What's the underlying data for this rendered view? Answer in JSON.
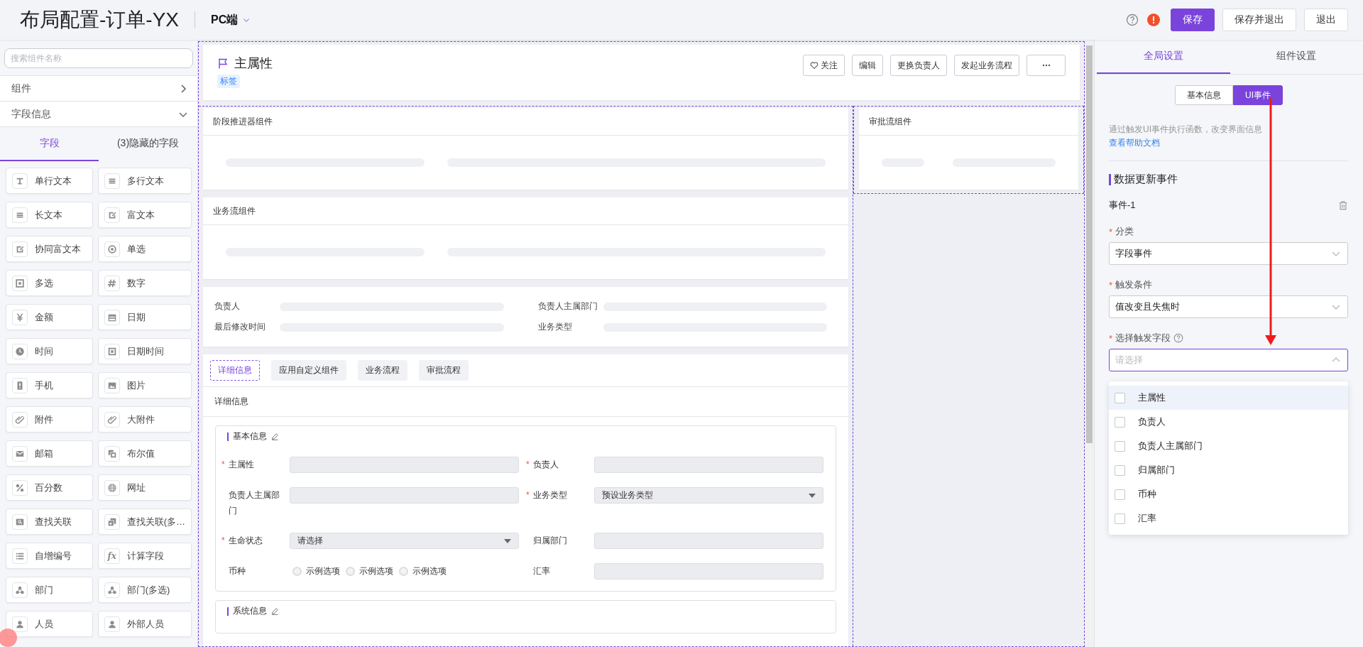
{
  "header": {
    "title": "布局配置-订单-YX",
    "platform": "PC端",
    "buttons": [
      {
        "label": "保存",
        "kind": "primary"
      },
      {
        "label": "保存并退出",
        "kind": "default"
      },
      {
        "label": "退出",
        "kind": "default"
      }
    ]
  },
  "sidebar": {
    "search": {
      "placeholder": "搜索组件名称"
    },
    "sections": [
      {
        "label": "组件",
        "expanded": false
      },
      {
        "label": "字段信息",
        "expanded": true
      }
    ],
    "tabs": [
      {
        "label": "字段",
        "selected": true
      },
      {
        "label": "(3)隐藏的字段",
        "selected": false
      }
    ],
    "fields": [
      {
        "label": "单行文本",
        "kind": "ibeam"
      },
      {
        "label": "多行文本",
        "kind": "lines"
      },
      {
        "label": "长文本",
        "kind": "lines"
      },
      {
        "label": "富文本",
        "kind": "editdoc"
      },
      {
        "label": "协同富文本",
        "kind": "editdoc"
      },
      {
        "label": "单选",
        "kind": "radio"
      },
      {
        "label": "多选",
        "kind": "checkbox"
      },
      {
        "label": "数字",
        "kind": "hash"
      },
      {
        "label": "金额",
        "kind": "yen"
      },
      {
        "label": "日期",
        "kind": "calendar"
      },
      {
        "label": "时间",
        "kind": "clock"
      },
      {
        "label": "日期时间",
        "kind": "datetime"
      },
      {
        "label": "手机",
        "kind": "phone"
      },
      {
        "label": "图片",
        "kind": "image"
      },
      {
        "label": "附件",
        "kind": "clip"
      },
      {
        "label": "大附件",
        "kind": "clip"
      },
      {
        "label": "邮箱",
        "kind": "mail"
      },
      {
        "label": "布尔值",
        "kind": "squares"
      },
      {
        "label": "百分数",
        "kind": "percent"
      },
      {
        "label": "网址",
        "kind": "globe"
      },
      {
        "label": "查找关联",
        "kind": "lookup"
      },
      {
        "label": "查找关联(多…",
        "kind": "squares2"
      },
      {
        "label": "自增编号",
        "kind": "list"
      },
      {
        "label": "计算字段",
        "kind": "glyph",
        "glyph": "fx"
      },
      {
        "label": "部门",
        "kind": "dept"
      },
      {
        "label": "部门(多选)",
        "kind": "dept"
      },
      {
        "label": "人员",
        "kind": "person"
      },
      {
        "label": "外部人员",
        "kind": "person"
      }
    ]
  },
  "canvas": {
    "record": {
      "title": "主属性",
      "tag": "标签",
      "actions": [
        {
          "label": "关注",
          "kind": "follow"
        },
        {
          "label": "编辑",
          "kind": "text"
        },
        {
          "label": "更换负责人",
          "kind": "text"
        },
        {
          "label": "发起业务流程",
          "kind": "text"
        },
        {
          "kind": "more"
        }
      ]
    },
    "components": [
      {
        "title": "阶段推进器组件"
      },
      {
        "title": "业务流组件"
      }
    ],
    "side_components": [
      {
        "title": "审批流组件"
      }
    ],
    "summary_fields": [
      "负责人",
      "负责人主属部门",
      "最后修改时间",
      "业务类型"
    ],
    "detail_tabs": [
      {
        "label": "详细信息",
        "selected": true
      },
      {
        "label": "应用自定义组件",
        "selected": false
      },
      {
        "label": "业务流程",
        "selected": false
      },
      {
        "label": "审批流程",
        "selected": false
      }
    ],
    "detail_title": "详细信息",
    "sections": [
      {
        "title": "基本信息",
        "fields": [
          {
            "label": "主属性",
            "required_mark": "*",
            "kind": "input"
          },
          {
            "label": "负责人",
            "required_mark": "*",
            "kind": "input"
          },
          {
            "label": "负责人主属部门",
            "kind": "input"
          },
          {
            "label": "业务类型",
            "required_mark": "*",
            "kind": "select",
            "value": "预设业务类型"
          },
          {
            "label": "生命状态",
            "required_mark": "*",
            "kind": "select",
            "value": "请选择"
          },
          {
            "label": "归属部门",
            "kind": "input"
          },
          {
            "label": "币种",
            "kind": "radio",
            "options": [
              "示例选项",
              "示例选项",
              "示例选项"
            ]
          },
          {
            "label": "汇率",
            "kind": "input"
          }
        ]
      },
      {
        "title": "系统信息"
      }
    ]
  },
  "settings": {
    "tabs": [
      {
        "label": "全局设置",
        "selected": true
      },
      {
        "label": "组件设置",
        "selected": false
      }
    ],
    "segments": [
      {
        "label": "基本信息",
        "selected": false
      },
      {
        "label": "UI事件",
        "selected": true
      }
    ],
    "description": "通过触发UI事件执行函数，改变界面信息",
    "help_link": "查看帮助文档",
    "section_title": "数据更新事件",
    "event": {
      "name": "事件-1",
      "fields": [
        {
          "label": "分类",
          "required_mark": "*",
          "value": "字段事件",
          "expanded": false
        },
        {
          "label": "触发条件",
          "required_mark": "*",
          "value": "值改变且失焦时",
          "expanded": false
        },
        {
          "label": "选择触发字段",
          "required_mark": "*",
          "placeholder": "请选择",
          "help": true,
          "expanded": true
        }
      ]
    },
    "dropdown": [
      {
        "label": "主属性",
        "checked": false,
        "hovered": true
      },
      {
        "label": "负责人",
        "checked": false,
        "hovered": false
      },
      {
        "label": "负责人主属部门",
        "checked": false,
        "hovered": false
      },
      {
        "label": "归属部门",
        "checked": false,
        "hovered": false
      },
      {
        "label": "币种",
        "checked": false,
        "hovered": false
      },
      {
        "label": "汇率",
        "checked": false,
        "hovered": false
      }
    ]
  }
}
